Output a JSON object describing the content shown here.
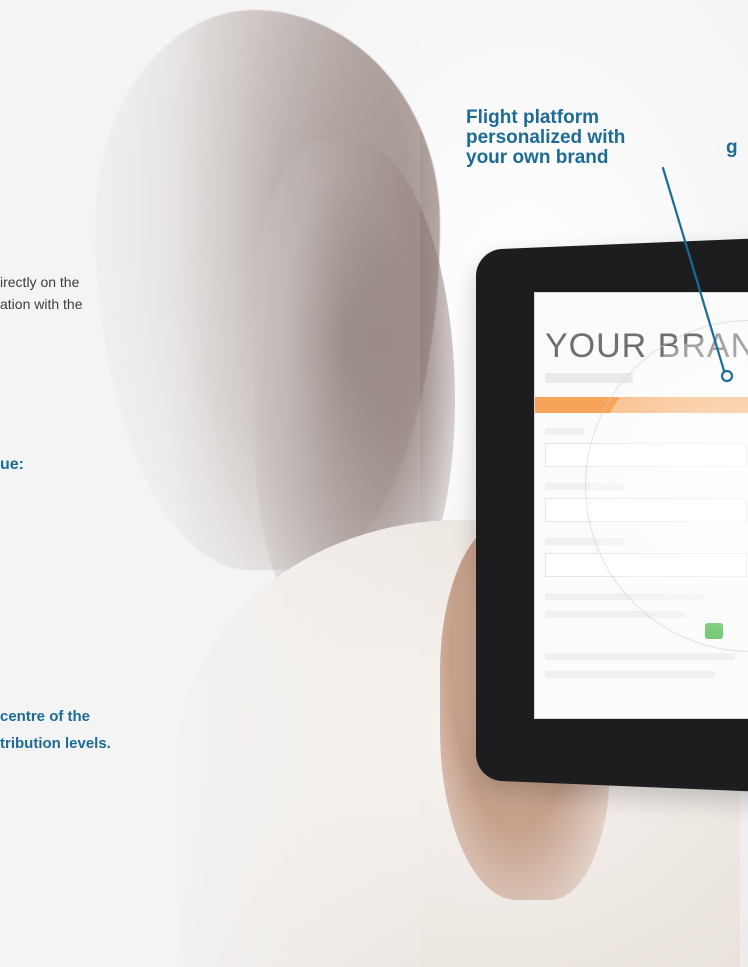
{
  "left_text": {
    "line1": "irectly on the",
    "line2": "ation with the",
    "heading": "ue:",
    "bottom_line1": "centre of the",
    "bottom_line2": "tribution levels."
  },
  "callout": {
    "line1": "Flight platform",
    "line2": "personalized with",
    "line3": "your own brand",
    "partial": "g"
  },
  "screen": {
    "brand_text": "YOUR BRAN"
  },
  "colors": {
    "accent_blue": "#1d6b97",
    "orange_bar": "#f7a45a",
    "screen_bg": "#fbfbfb"
  }
}
